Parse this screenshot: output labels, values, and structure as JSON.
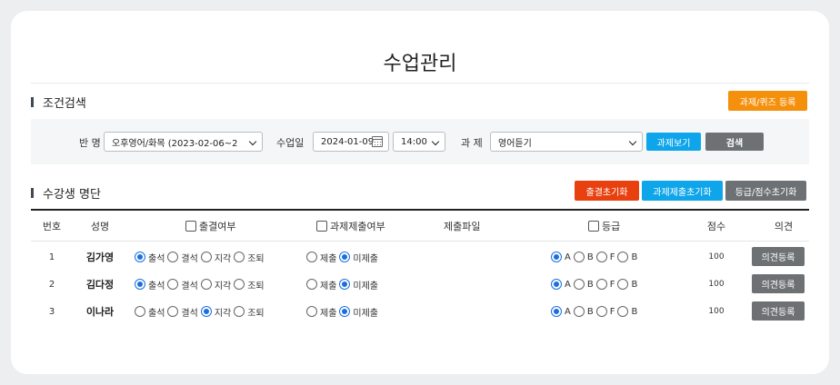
{
  "page_title": "수업관리",
  "search_section": {
    "title": "조건검색",
    "register_button": "과제/퀴즈 등록",
    "class_label": "반 명",
    "class_value": "오후영어/화목 (2023-02-06~2",
    "date_label": "수업일",
    "date_value": "2024-01-09",
    "time_value": "14:00",
    "assignment_label": "과 제",
    "assignment_value": "영어듣기",
    "view_assignment_button": "과제보기",
    "search_button": "검색"
  },
  "roster_section": {
    "title": "수강생 명단",
    "reset_attendance_button": "출결초기화",
    "reset_submission_button": "과제제출초기화",
    "reset_grade_button": "등급/점수초기화"
  },
  "table": {
    "headers": {
      "no": "번호",
      "name": "성명",
      "attendance": "출결여부",
      "submission": "과제제출여부",
      "file": "제출파일",
      "grade": "등급",
      "score": "점수",
      "opinion": "의견"
    },
    "attendance_options": [
      "출석",
      "결석",
      "지각",
      "조퇴"
    ],
    "submission_options": [
      "제출",
      "미제출"
    ],
    "grade_options": [
      "A",
      "B",
      "F",
      "B"
    ],
    "opinion_button": "의견등록",
    "rows": [
      {
        "no": "1",
        "name": "김가영",
        "attendance": 0,
        "submission": 1,
        "grade": 0,
        "score": "100"
      },
      {
        "no": "2",
        "name": "김다정",
        "attendance": 0,
        "submission": 1,
        "grade": 0,
        "score": "100"
      },
      {
        "no": "3",
        "name": "이나라",
        "attendance": 2,
        "submission": 1,
        "grade": 0,
        "score": "100"
      }
    ]
  }
}
